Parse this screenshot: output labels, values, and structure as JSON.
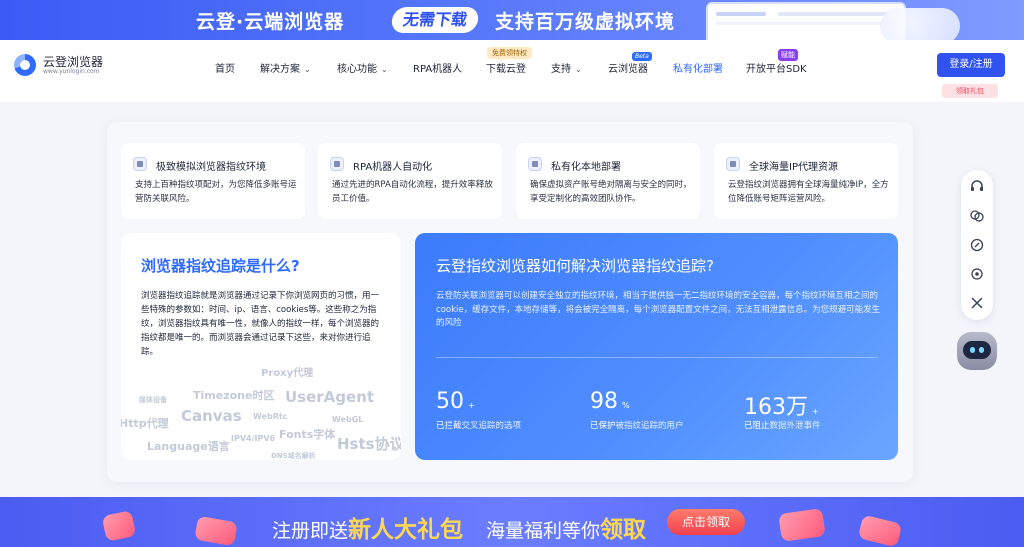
{
  "top_banner": {
    "left_text": "云登·云端浏览器",
    "pill_text": "无需下载",
    "right_text": "支持百万级虚拟环境"
  },
  "header": {
    "logo_name": "云登浏览器",
    "logo_url": "www.yunlogin.com",
    "nav": [
      {
        "label": "首页"
      },
      {
        "label": "解决方案"
      },
      {
        "label": "核心功能"
      },
      {
        "label": "RPA机器人"
      },
      {
        "label": "下载云登"
      },
      {
        "label": "支持"
      },
      {
        "label": "云浏览器"
      },
      {
        "label": "私有化部署"
      },
      {
        "label": "开放平台SDK"
      }
    ],
    "badges": {
      "free": "免费领特权",
      "beta": "Beta",
      "new": "赋能"
    },
    "login_label": "登录/注册",
    "gift_label": "领取礼包"
  },
  "features": [
    {
      "title": "极致模拟浏览器指纹环境",
      "desc": "支持上百种指纹项配对，为您降低多账号运营防关联风险。"
    },
    {
      "title": "RPA机器人自动化",
      "desc": "通过先进的RPA自动化流程，提升效率释放员工价值。"
    },
    {
      "title": "私有化本地部署",
      "desc": "确保虚拟资产账号绝对隔离与安全的同时，享受定制化的高效团队协作。"
    },
    {
      "title": "全球海量IP代理资源",
      "desc": "云登指纹浏览器拥有全球海量纯净IP，全方位降低账号矩阵运营风险。"
    }
  ],
  "what": {
    "title": "浏览器指纹追踪是什么?",
    "body": "浏览器指纹追踪就是浏览器通过记录下你浏览网页的习惯，用一些特殊的参数如：时间、ip、语言、cookies等。这些称之为指纹，浏览器指纹具有唯一性，就像人的指纹一样，每个浏览器的指纹都是唯一的。而浏览器会通过记录下这些，来对你进行追踪。",
    "cloud_words": [
      "Proxy代理",
      "媒体设备",
      "Timezone时区",
      "UserAgent",
      "Http代理",
      "Canvas",
      "WebRtc",
      "WebGL",
      "Fonts字体",
      "Language语言",
      "IPV4/IPV6",
      "Hsts协议",
      "DNS域名解析"
    ]
  },
  "how": {
    "title": "云登指纹浏览器如何解决浏览器指纹追踪?",
    "body": "云登防关联浏览器可以创建安全独立的指纹环境，相当于提供独一无二指纹环境的安全容器，每个指纹环境互相之间的cookie，缓存文件，本地存储等，将会被完全隔离，每个浏览器配置文件之间，无法互相泄露信息。为您规避可能发生的风险",
    "stats": [
      {
        "num": "50",
        "unit": "+",
        "label_strong": "已拦截",
        "label_rest": "交叉追踪的选项"
      },
      {
        "num": "98",
        "unit": "%",
        "label_strong": "已保护",
        "label_rest": "被指纹追踪的用户"
      },
      {
        "num": "163万",
        "unit": "+",
        "label_strong": "已阻止",
        "label_rest": "数据外泄事件"
      }
    ]
  },
  "promo": {
    "text1_prefix": "注册即送",
    "text1_highlight": "新人大礼包",
    "text2_prefix": "海量福利等你",
    "text2_highlight": "领取",
    "button_label": "点击领取"
  },
  "float_tools": [
    "headset-icon",
    "chat-icon",
    "link-icon",
    "refresh-icon",
    "tools-icon"
  ],
  "colors": {
    "accent": "#2f6bff",
    "brand_blue": "#2f52f0",
    "promo_yellow": "#ffd84d"
  }
}
